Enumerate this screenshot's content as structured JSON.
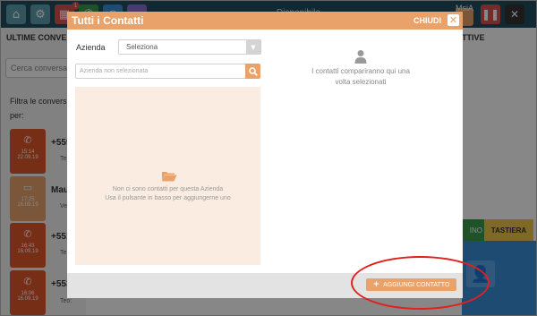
{
  "topbar": {
    "calendar_badge": "1",
    "status": "Disponibile",
    "user": "MsiA"
  },
  "left": {
    "tab_label": "ULTIME CONVE",
    "search_placeholder": "Cerca conversaz",
    "filter_label_1": "Filtra le convers",
    "filter_label_2": "per:",
    "conversations": [
      {
        "time": "15:14",
        "date": "22.09.19",
        "name": "+559",
        "sub": "Te"
      },
      {
        "time": "17:25",
        "date": "16.09.19",
        "name": "Mau",
        "sub": "Vedi"
      },
      {
        "time": "16:43",
        "date": "16.09.19",
        "name": "+551",
        "sub": "Te"
      },
      {
        "time": "16:06",
        "date": "16.09.19",
        "name": "+553",
        "sub": "Teo:"
      }
    ]
  },
  "right": {
    "tab_label": "TTIVE",
    "green_tab_label": "INO",
    "keypad_tab_label": "TASTIERA"
  },
  "modal": {
    "title": "Tutti i Contatti",
    "close_label": "CHIUDI",
    "azienda_label": "Azienda",
    "azienda_value": "Seleziona",
    "search_placeholder": "Azienda non selezionata",
    "empty_line1": "Non ci sono contatti per questa Azienda",
    "empty_line2": "Usa il pulsante in basso per aggiungerne uno",
    "right_line1": "I contatti compariranno qui una",
    "right_line2": "volta selezionati",
    "add_button": "AGGIUNGI CONTATTO"
  },
  "colors": {
    "accent_orange": "#e9a36a",
    "empty_bg": "#fbece1",
    "footer_bg": "#e3e3e3",
    "annotation_red": "#e0211c"
  }
}
